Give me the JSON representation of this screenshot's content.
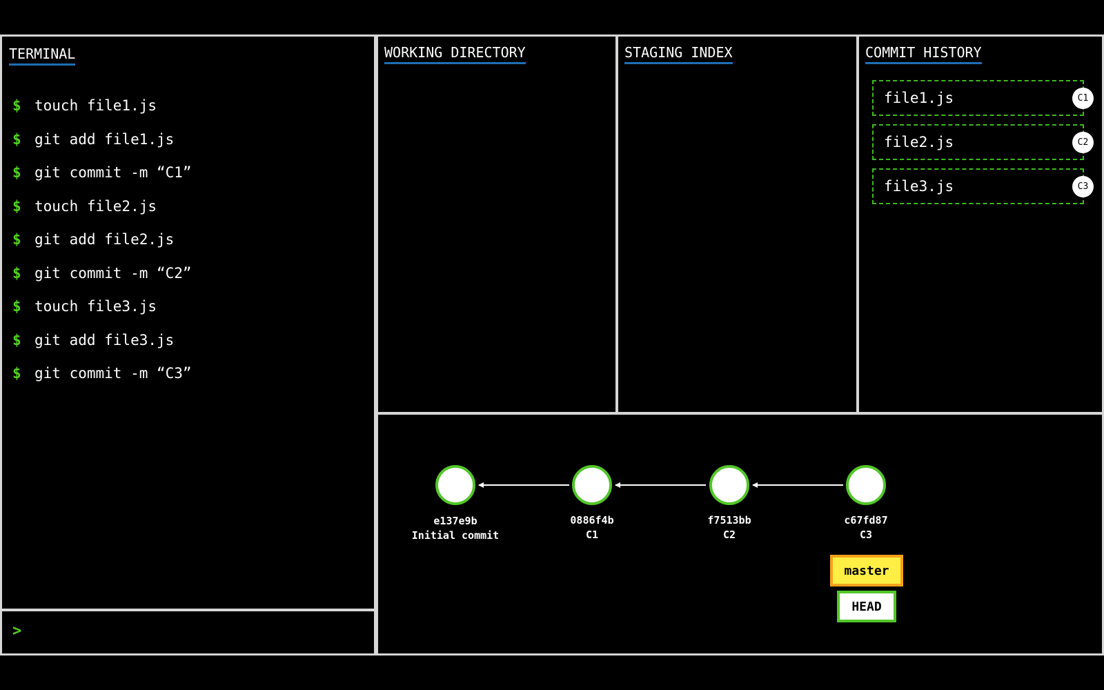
{
  "terminal": {
    "title": "TERMINAL",
    "prompt_symbol": "$",
    "commands": [
      "touch file1.js",
      "git add file1.js",
      "git commit -m “C1”",
      "touch file2.js",
      "git add file2.js",
      "git commit -m “C2”",
      "touch file3.js",
      "git add file3.js",
      "git commit -m “C3”"
    ],
    "input_prompt": ">",
    "input_value": ""
  },
  "working_directory": {
    "title": "WORKING DIRECTORY",
    "files": []
  },
  "staging_index": {
    "title": "STAGING INDEX",
    "files": []
  },
  "commit_history": {
    "title": "COMMIT HISTORY",
    "files": [
      {
        "name": "file1.js",
        "commit": "C1"
      },
      {
        "name": "file2.js",
        "commit": "C2"
      },
      {
        "name": "file3.js",
        "commit": "C3"
      }
    ]
  },
  "graph": {
    "commits": [
      {
        "hash": "e137e9b",
        "message": "Initial commit"
      },
      {
        "hash": "0886f4b",
        "message": "C1"
      },
      {
        "hash": "f7513bb",
        "message": "C2"
      },
      {
        "hash": "c67fd87",
        "message": "C3"
      }
    ],
    "branch": "master",
    "head": "HEAD",
    "colors": {
      "node_border": "#52c629",
      "branch_fill": "#ffee44",
      "branch_border": "#f6a11a",
      "head_border": "#52c629",
      "prompt": "#52d21e",
      "title_underline": "#1f6fb5"
    }
  }
}
